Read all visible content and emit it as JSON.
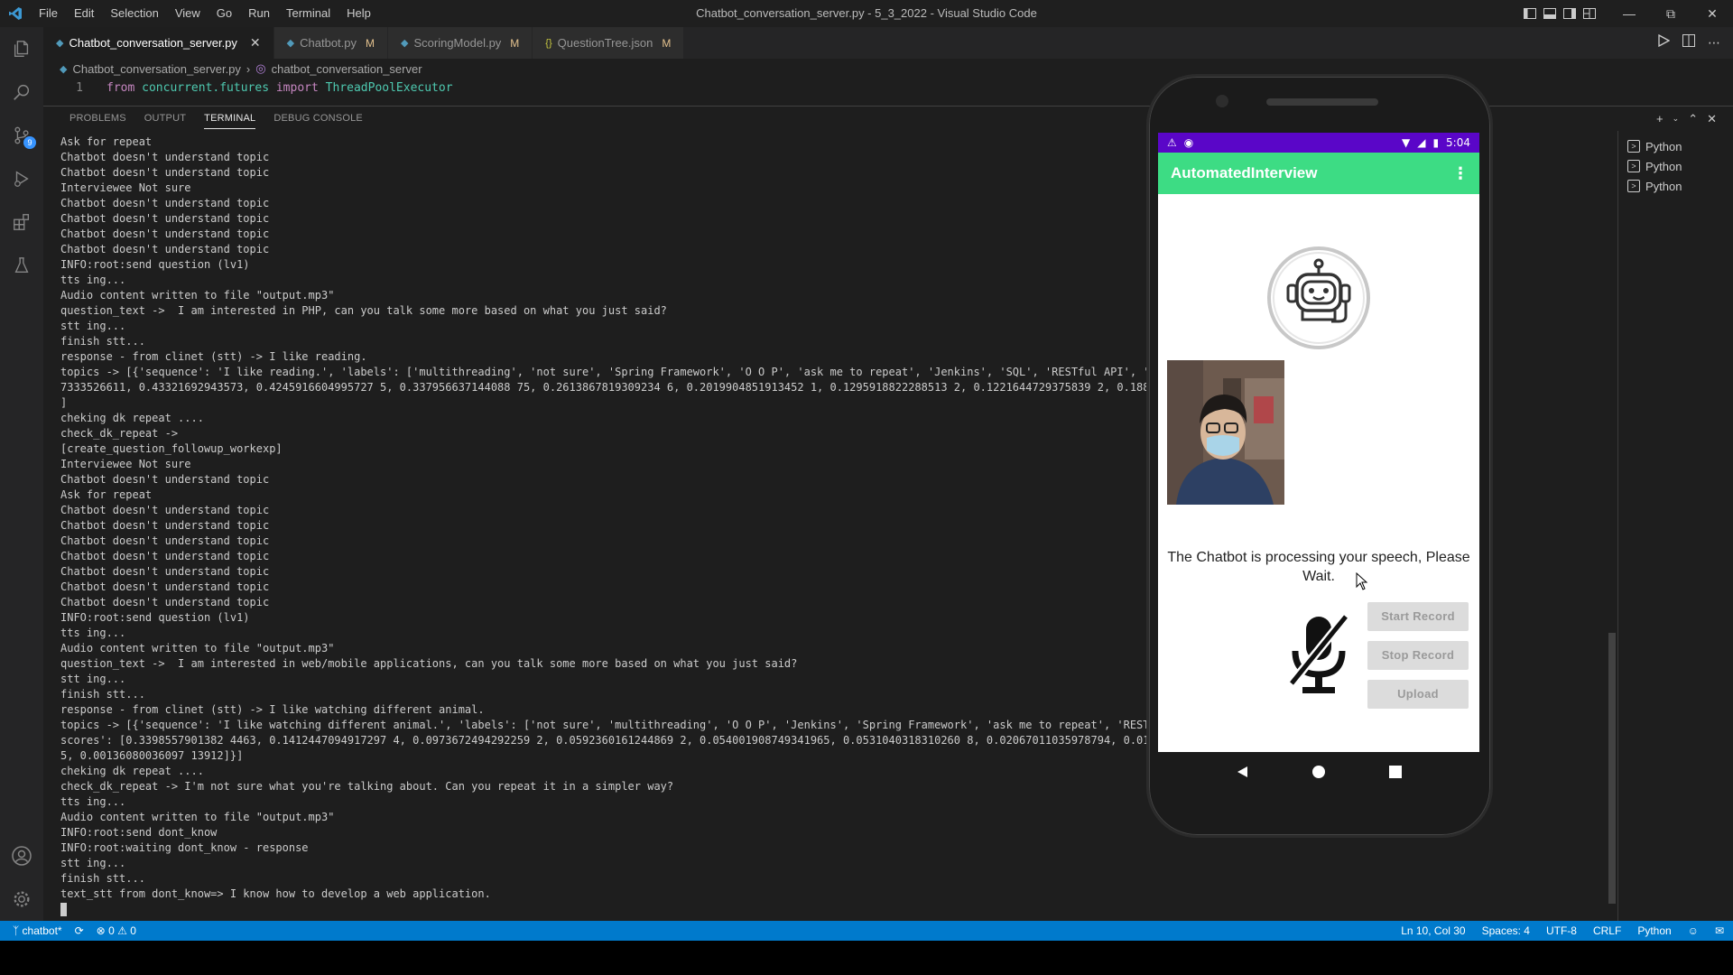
{
  "app": {
    "window_title": "Chatbot_conversation_server.py - 5_3_2022 - Visual Studio Code",
    "menu": [
      "File",
      "Edit",
      "Selection",
      "View",
      "Go",
      "Run",
      "Terminal",
      "Help"
    ]
  },
  "tabs": [
    {
      "label": "Chatbot_conversation_server.py",
      "modified": "",
      "active": true
    },
    {
      "label": "Chatbot.py",
      "modified": "M",
      "active": false
    },
    {
      "label": "ScoringModel.py",
      "modified": "M",
      "active": false
    },
    {
      "label": "QuestionTree.json",
      "modified": "M",
      "active": false
    }
  ],
  "breadcrumb": {
    "file": "Chatbot_conversation_server.py",
    "symbol": "chatbot_conversation_server"
  },
  "code": {
    "line_number": "1",
    "kw_from": "from",
    "module": "concurrent.futures",
    "kw_import": "import",
    "name": "ThreadPoolExecutor"
  },
  "panel": {
    "tabs": [
      "PROBLEMS",
      "OUTPUT",
      "TERMINAL",
      "DEBUG CONSOLE"
    ],
    "active_tab": "TERMINAL",
    "terminals": [
      "Python",
      "Python",
      "Python"
    ],
    "lines": [
      "Ask for repeat",
      "Chatbot doesn't understand topic",
      "Chatbot doesn't understand topic",
      "Interviewee Not sure",
      "Chatbot doesn't understand topic",
      "Chatbot doesn't understand topic",
      "Chatbot doesn't understand topic",
      "Chatbot doesn't understand topic",
      "INFO:root:send question (lv1)",
      "tts ing...",
      "Audio content written to file \"output.mp3\"",
      "question_text ->  I am interested in PHP, can you talk some more based on what you just said?",
      "stt ing...",
      "finish stt...",
      "response - from clinet (stt) -> I like reading.",
      "topics -> [{'sequence': 'I like reading.', 'labels': ['multithreading', 'not sure', 'Spring Framework', 'O O P', 'ask me to repeat', 'Jenkins', 'SQL', 'RESTful API', 'PHP', 'ores': [0.662724",
      "7333526611, 0.43321692943573, 0.4245916604995727 5, 0.337956637144088 75, 0.2613867819309234 6, 0.2019904851913452 1, 0.1295918822288513 2, 0.1221644729375839 2, 0.1885126996040 981763787567 62]}]",
      "]",
      "cheking dk repeat ....",
      "check_dk_repeat ->",
      "[create_question_followup_workexp]",
      "Interviewee Not sure",
      "Chatbot doesn't understand topic",
      "Ask for repeat",
      "Chatbot doesn't understand topic",
      "Chatbot doesn't understand topic",
      "Chatbot doesn't understand topic",
      "Chatbot doesn't understand topic",
      "Chatbot doesn't understand topic",
      "Chatbot doesn't understand topic",
      "Chatbot doesn't understand topic",
      "INFO:root:send question (lv1)",
      "tts ing...",
      "Audio content written to file \"output.mp3\"",
      "question_text ->  I am interested in web/mobile applications, can you talk some more based on what you just said?",
      "stt ing...",
      "finish stt...",
      "response - from clinet (stt) -> I like watching different animal.",
      "topics -> [{'sequence': 'I like watching different animal.', 'labels': ['not sure', 'multithreading', 'O O P', 'Jenkins', 'Spring Framework', 'ask me to repeat', 'RESTful A pplications'], '",
      "scores': [0.3398557901382 4463, 0.1412447094917297 4, 0.0973672494292259 2, 0.0592360161244869 2, 0.054001908749341965, 0.0531040318310260 8, 0.02067011035978794, 0.0185645297 1014695652062073 3",
      "5, 0.00136080036097 13912]}]",
      "cheking dk repeat ....",
      "check_dk_repeat -> I'm not sure what you're talking about. Can you repeat it in a simpler way?",
      "tts ing...",
      "Audio content written to file \"output.mp3\"",
      "INFO:root:send dont_know",
      "INFO:root:waiting dont_know - response",
      "stt ing...",
      "finish stt...",
      "text_stt from dont_know=> I know how to develop a web application."
    ]
  },
  "status": {
    "branch": "chatbot*",
    "errors": "0",
    "warnings": "0",
    "position": "Ln 10, Col 30",
    "spaces": "Spaces: 4",
    "encoding": "UTF-8",
    "eol": "CRLF",
    "language": "Python"
  },
  "phone": {
    "time": "5:04",
    "app_title": "AutomatedInterview",
    "processing_text": "The Chatbot is processing your speech, Please Wait.",
    "buttons": {
      "start": "Start Record",
      "stop": "Stop Record",
      "upload": "Upload"
    }
  },
  "colors": {
    "accent_status": "#007acc",
    "android_statusbar": "#5a06c8",
    "appbar": "#3ddc84"
  }
}
